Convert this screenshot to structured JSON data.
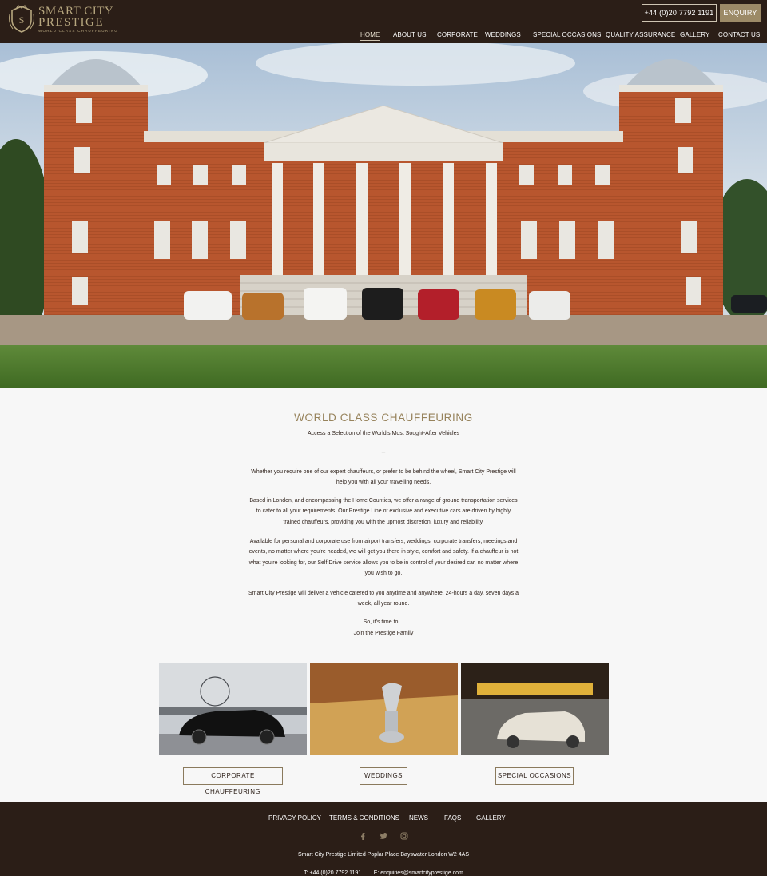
{
  "brand": {
    "name_line1": "SMART CITY",
    "name_line2": "PRESTIGE",
    "tagline": "WORLD CLASS CHAUFFEURING"
  },
  "header": {
    "phone": "+44 (0)20 7792 1191",
    "enquiry": "ENQUIRY"
  },
  "nav": [
    {
      "label": "HOME"
    },
    {
      "label": "ABOUT US"
    },
    {
      "label": "CORPORATE"
    },
    {
      "label": "WEDDINGS"
    },
    {
      "label": "SPECIAL OCCASIONS"
    },
    {
      "label": "QUALITY ASSURANCE"
    },
    {
      "label": "GALLERY"
    },
    {
      "label": "CONTACT US"
    }
  ],
  "main": {
    "title": "WORLD CLASS CHAUFFEURING",
    "subtitle": "Access a Selection of the World’s Most Sought-After Vehicles",
    "dash": "–",
    "paragraphs": [
      "Whether you require one of our expert chauffeurs, or prefer to be behind the wheel, Smart City Prestige will help you with all your travelling needs.",
      "Based in London, and encompassing the Home Counties, we offer a range of ground transportation services to cater to all your requirements. Our Prestige Line of exclusive and executive cars are driven by highly trained chauffeurs, providing you with the upmost discretion, luxury and reliability.",
      "Available for personal and corporate use from airport transfers, weddings, corporate transfers, meetings and events, no matter where you’re headed, we will get you there in style, comfort and safety. If a chauffeur is not what you’re looking for, our Self Drive service allows you to be in control of your desired car, no matter where you wish to go.",
      "Smart City Prestige will deliver a vehicle catered to you anytime and anywhere, 24-hours a day, seven days a week, all year round."
    ],
    "closing_line1": "So, it’s time to…",
    "closing_line2": "Join the Prestige Family"
  },
  "services": [
    {
      "label": "CORPORATE CHAUFFEURING"
    },
    {
      "label": "WEDDINGS"
    },
    {
      "label": "SPECIAL OCCASIONS"
    }
  ],
  "footer": {
    "links": [
      "PRIVACY POLICY",
      "TERMS & CONDITIONS",
      "NEWS",
      "FAQS",
      "GALLERY"
    ],
    "address": "Smart City Prestige Limited  Poplar Place  Bayswater  London  W2 4AS",
    "contact": "T: +44 (0)20 7792 1191        E: enquiries@smartcityprestige.com"
  },
  "colors": {
    "header_bg": "#2b1e17",
    "accent_gold": "#97835c",
    "enquiry_bg": "#9c8a67"
  },
  "icons": [
    "facebook-icon",
    "twitter-icon",
    "instagram-icon"
  ]
}
